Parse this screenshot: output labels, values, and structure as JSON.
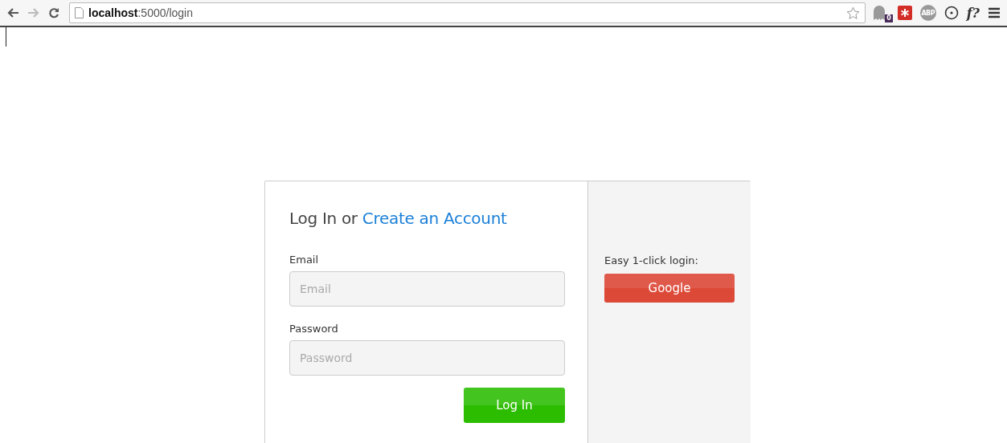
{
  "browser": {
    "url": "**localhost**:5000/login",
    "extensions": [
      {
        "kind": "ghost",
        "badge": "0"
      },
      {
        "kind": "lastpass"
      },
      {
        "kind": "abp",
        "label": "ABP"
      },
      {
        "kind": "target"
      },
      {
        "kind": "text",
        "label": "f?"
      }
    ]
  },
  "login": {
    "heading": "Log In or",
    "create_link": "Create an Account",
    "fields": [
      {
        "label": "Email",
        "placeholder": "Email"
      },
      {
        "label": "Password",
        "placeholder": "Password"
      }
    ],
    "submit": "Log In"
  },
  "social": {
    "label": "Easy 1-click login:",
    "button": "Google"
  }
}
